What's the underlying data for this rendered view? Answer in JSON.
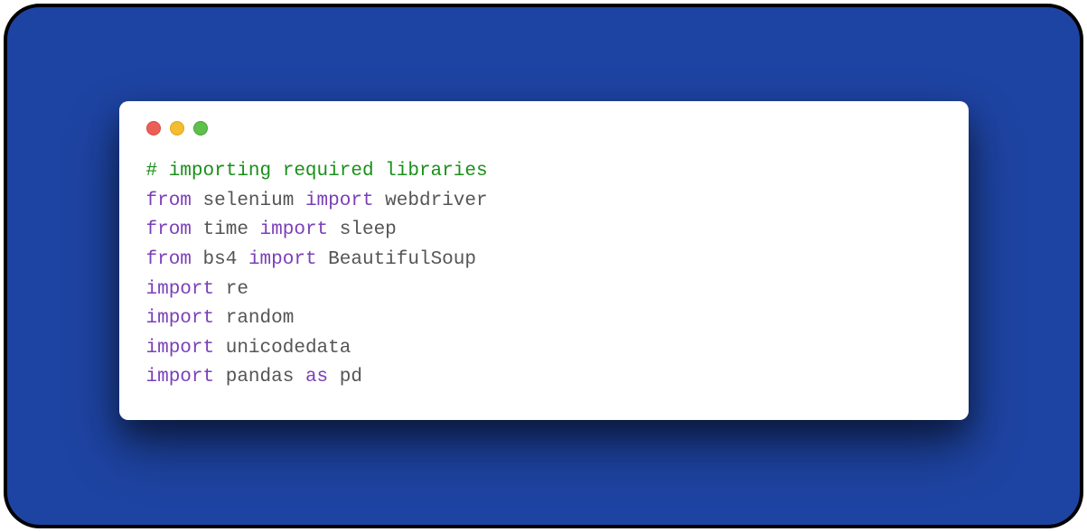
{
  "colors": {
    "background": "#1e44a3",
    "window": "#ffffff",
    "dot_red": "#ec5f56",
    "dot_yellow": "#f4bd2f",
    "dot_green": "#5ec14b",
    "comment": "#1a8f1a",
    "keyword": "#7b3fb8",
    "ident": "#555555"
  },
  "language": "python",
  "code_lines": [
    [
      {
        "cls": "c-comment",
        "text": "# importing required libraries"
      }
    ],
    [
      {
        "cls": "c-keyword",
        "text": "from"
      },
      {
        "cls": "c-ident",
        "text": " selenium "
      },
      {
        "cls": "c-keyword",
        "text": "import"
      },
      {
        "cls": "c-ident",
        "text": " webdriver"
      }
    ],
    [
      {
        "cls": "c-keyword",
        "text": "from"
      },
      {
        "cls": "c-ident",
        "text": " time "
      },
      {
        "cls": "c-keyword",
        "text": "import"
      },
      {
        "cls": "c-ident",
        "text": " sleep"
      }
    ],
    [
      {
        "cls": "c-keyword",
        "text": "from"
      },
      {
        "cls": "c-ident",
        "text": " bs4 "
      },
      {
        "cls": "c-keyword",
        "text": "import"
      },
      {
        "cls": "c-ident",
        "text": " BeautifulSoup"
      }
    ],
    [
      {
        "cls": "c-keyword",
        "text": "import"
      },
      {
        "cls": "c-ident",
        "text": " re"
      }
    ],
    [
      {
        "cls": "c-keyword",
        "text": "import"
      },
      {
        "cls": "c-ident",
        "text": " random"
      }
    ],
    [
      {
        "cls": "c-keyword",
        "text": "import"
      },
      {
        "cls": "c-ident",
        "text": " unicodedata"
      }
    ],
    [
      {
        "cls": "c-keyword",
        "text": "import"
      },
      {
        "cls": "c-ident",
        "text": " pandas "
      },
      {
        "cls": "c-keyword",
        "text": "as"
      },
      {
        "cls": "c-ident",
        "text": " pd"
      }
    ]
  ]
}
